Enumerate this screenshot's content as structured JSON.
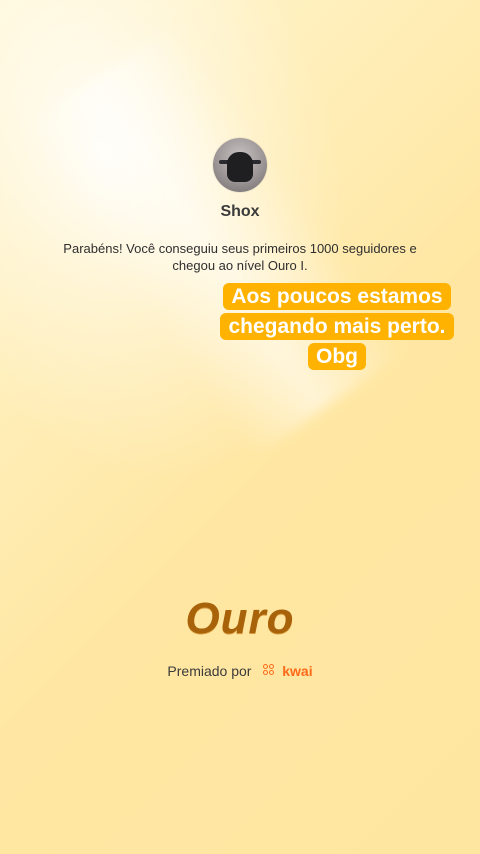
{
  "profile": {
    "username": "Shox",
    "avatar_icon": "motorcycle-rider-avatar"
  },
  "message": "Parabéns! Você conseguiu seus primeiros 1000 seguidores e chegou ao nível Ouro I.",
  "overlay_text": "Aos poucos estamos chegando mais perto. Obg",
  "tier": "Ouro",
  "award": {
    "label": "Premiado por",
    "brand": "kwai",
    "brand_icon": "kwai-logo-icon",
    "brand_color": "#ff6a1a"
  },
  "colors": {
    "background": "#ffe7a3",
    "tier_text": "#a8620a",
    "overlay_bg": "#ffb300"
  }
}
